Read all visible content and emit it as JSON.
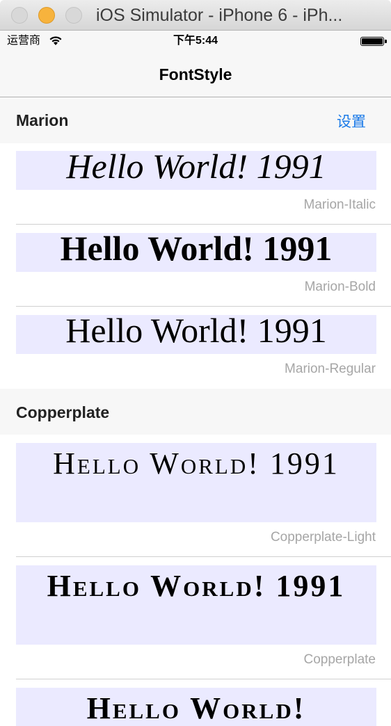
{
  "window": {
    "title": "iOS Simulator - iPhone 6 - iPh..."
  },
  "status_bar": {
    "carrier": "运营商",
    "time": "下午5:44"
  },
  "nav": {
    "title": "FontStyle"
  },
  "sections": [
    {
      "title": "Marion",
      "action_label": "设置",
      "rows": [
        {
          "sample": "Hello World! 1991",
          "font_name": "Marion-Italic"
        },
        {
          "sample": "Hello World! 1991",
          "font_name": "Marion-Bold"
        },
        {
          "sample": "Hello World! 1991",
          "font_name": "Marion-Regular"
        }
      ]
    },
    {
      "title": "Copperplate",
      "rows": [
        {
          "sample": "Hello World! 1991",
          "font_name": "Copperplate-Light"
        },
        {
          "sample": "Hello World! 1991",
          "font_name": "Copperplate"
        },
        {
          "sample": "Hello World!"
        }
      ]
    }
  ]
}
